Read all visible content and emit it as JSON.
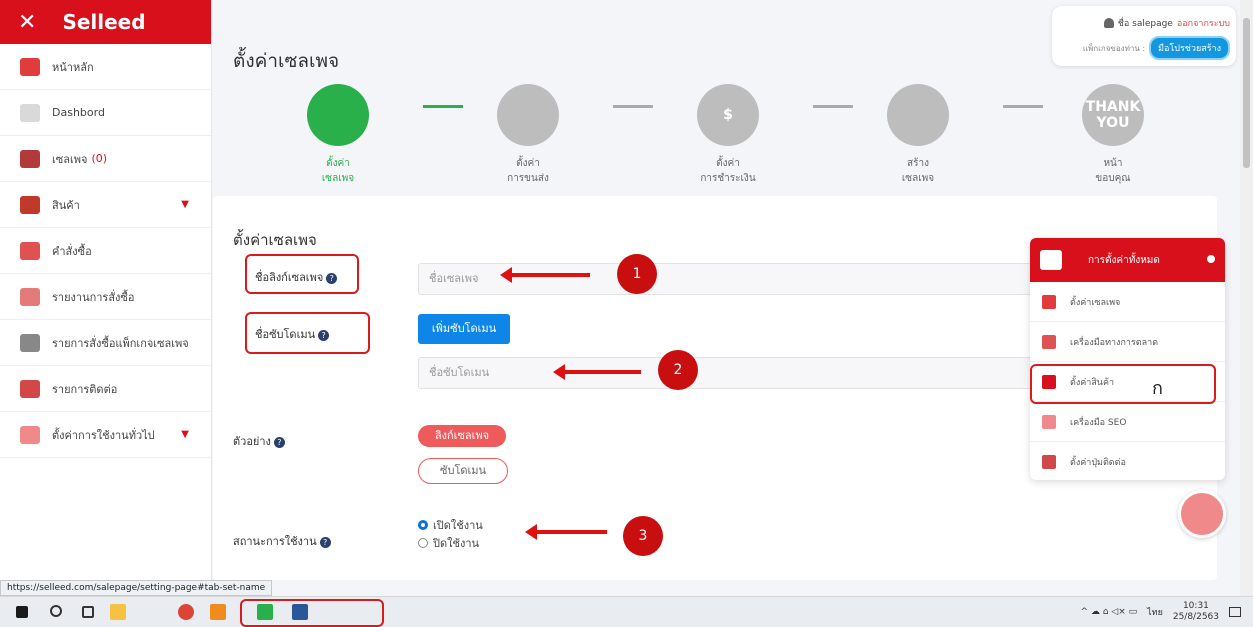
{
  "sidebar": {
    "close_icon": "✕",
    "brand": "Selleed",
    "items": [
      {
        "label": "หน้าหลัก",
        "icon": "home-icon",
        "color": "#e23b3b"
      },
      {
        "label": "Dashbord",
        "icon": "dashboard-icon",
        "color": "#d9d9d9"
      },
      {
        "label": "เซลเพจ",
        "count": "(0)",
        "icon": "salepage-icon",
        "color": "#b23a3a"
      },
      {
        "label": "สินค้า",
        "icon": "product-icon",
        "color": "#c0392b",
        "caret": "▼"
      },
      {
        "label": "คำสั่งซื้อ",
        "icon": "order-icon",
        "color": "#e05252"
      },
      {
        "label": "รายงานการสั่งซื้อ",
        "icon": "report-icon",
        "color": "#e37b7b"
      },
      {
        "label": "รายการสั่งซื้อแพ็กเกจเซลเพจ",
        "icon": "package-icon",
        "color": "#888888"
      },
      {
        "label": "รายการติดต่อ",
        "icon": "contact-icon",
        "color": "#d24848"
      },
      {
        "label": "ตั้งค่าการใช้งานทั่วไป",
        "icon": "settings-icon",
        "color": "#f08a8a",
        "caret": "▼"
      }
    ]
  },
  "header": {
    "title": "ตั้งค่าเซลเพจ",
    "user_name": "ชื่อ salepage",
    "logout": "ออกจากระบบ",
    "package": "แพ็กเกจของท่าน :",
    "help_button": "มือโปรช่วยสร้าง"
  },
  "steps": [
    {
      "line1": "ตั้งค่า",
      "line2": "เซลเพจ",
      "icon": "store-icon",
      "active": true,
      "text": ""
    },
    {
      "line1": "ตั้งค่า",
      "line2": "การขนส่ง",
      "icon": "truck-icon",
      "active": false,
      "text": ""
    },
    {
      "line1": "ตั้งค่า",
      "line2": "การชำระเงิน",
      "icon": "dollar-icon",
      "active": false,
      "text": "$"
    },
    {
      "line1": "สร้าง",
      "line2": "เซลเพจ",
      "icon": "monitor-icon",
      "active": false,
      "text": ""
    },
    {
      "line1": "หน้า",
      "line2": "ขอบคุณ",
      "icon": "thank-you-icon",
      "active": false,
      "text": "THANK YOU"
    }
  ],
  "form": {
    "title": "ตั้งค่าเซลเพจ",
    "link_label": "ชื่อลิงก์เซลเพจ",
    "link_placeholder": "ชื่อเซลเพจ",
    "sub_label": "ชื่อซับโดเมน",
    "add_sub_button": "เพิ่มซับโดเมน",
    "sub_placeholder": "ชื่อซับโดเมน",
    "example_label": "ตัวอย่าง",
    "example_link": "ลิงก์เซลเพจ",
    "example_sub": "ซับโดเมน",
    "status_label": "สถานะการใช้งาน",
    "status_on": "เปิดใช้งาน",
    "status_off": "ปิดใช้งาน",
    "help_icon": "?"
  },
  "annotations": {
    "n1": "1",
    "n2": "2",
    "n3": "3",
    "mark": "ก"
  },
  "settings_panel": {
    "title": "การตั้งค่าทั้งหมด",
    "items": [
      {
        "label": "ตั้งค่าเซลเพจ",
        "icon": "store-icon",
        "color": "#e23b3b"
      },
      {
        "label": "เครื่องมือทางการตลาด",
        "icon": "cart-icon",
        "color": "#e05252"
      },
      {
        "label": "ตั้งค่าสินค้า",
        "icon": "box-icon",
        "color": "#d7101c"
      },
      {
        "label": "เครื่องมือ SEO",
        "icon": "seo-icon",
        "color": "#f08a8a"
      },
      {
        "label": "ตั้งค่าปุ่มติดต่อ",
        "icon": "contact-icon",
        "color": "#d24848"
      }
    ]
  },
  "status_url": "https://selleed.com/salepage/setting-page#tab-set-name",
  "taskbar": {
    "time": "10:31",
    "date": "25/8/2563",
    "lang": "ไทย",
    "tray_icons": "^ ☁ ⌂ ◁× ▭"
  }
}
